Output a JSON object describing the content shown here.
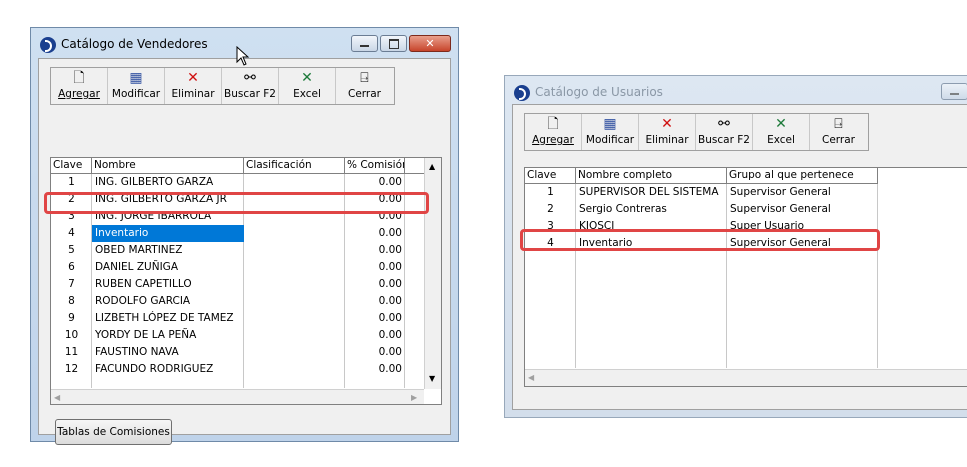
{
  "vendedores": {
    "title": "Catálogo de Vendedores",
    "toolbar": [
      {
        "label": "Agregar",
        "icon": "new-document-icon"
      },
      {
        "label": "Modificar",
        "icon": "edit-icon"
      },
      {
        "label": "Eliminar",
        "icon": "delete-x-icon"
      },
      {
        "label": "Buscar F2",
        "icon": "binoculars-icon"
      },
      {
        "label": "Excel",
        "icon": "excel-icon"
      },
      {
        "label": "Cerrar",
        "icon": "exit-door-icon"
      }
    ],
    "columns": [
      "Clave",
      "Nombre",
      "Clasificación",
      "% Comisión"
    ],
    "rows": [
      {
        "clave": "1",
        "nombre": "ING. GILBERTO GARZA",
        "clasificacion": "",
        "comision": "0.00"
      },
      {
        "clave": "2",
        "nombre": "ING. GILBERTO GARZA JR",
        "clasificacion": "",
        "comision": "0.00"
      },
      {
        "clave": "3",
        "nombre": "ING. JORGE IBARROLA",
        "clasificacion": "",
        "comision": "0.00"
      },
      {
        "clave": "4",
        "nombre": "Inventario",
        "clasificacion": "",
        "comision": "0.00"
      },
      {
        "clave": "5",
        "nombre": "OBED MARTINEZ",
        "clasificacion": "",
        "comision": "0.00"
      },
      {
        "clave": "6",
        "nombre": "DANIEL ZUÑIGA",
        "clasificacion": "",
        "comision": "0.00"
      },
      {
        "clave": "7",
        "nombre": "RUBEN CAPETILLO",
        "clasificacion": "",
        "comision": "0.00"
      },
      {
        "clave": "8",
        "nombre": "RODOLFO GARCIA",
        "clasificacion": "",
        "comision": "0.00"
      },
      {
        "clave": "9",
        "nombre": "LIZBETH LÓPEZ DE TAMEZ",
        "clasificacion": "",
        "comision": "0.00"
      },
      {
        "clave": "10",
        "nombre": "YORDY DE LA PEÑA",
        "clasificacion": "",
        "comision": "0.00"
      },
      {
        "clave": "11",
        "nombre": "FAUSTINO NAVA",
        "clasificacion": "",
        "comision": "0.00"
      },
      {
        "clave": "12",
        "nombre": "FACUNDO RODRIGUEZ",
        "clasificacion": "",
        "comision": "0.00"
      }
    ],
    "selected_row": 3,
    "tablas_button": "Tablas de Comisiones"
  },
  "usuarios": {
    "title": "Catálogo de Usuarios",
    "toolbar": [
      {
        "label": "Agregar",
        "icon": "new-document-icon"
      },
      {
        "label": "Modificar",
        "icon": "edit-icon"
      },
      {
        "label": "Eliminar",
        "icon": "delete-x-icon"
      },
      {
        "label": "Buscar F2",
        "icon": "binoculars-icon"
      },
      {
        "label": "Excel",
        "icon": "excel-icon"
      },
      {
        "label": "Cerrar",
        "icon": "exit-door-icon"
      }
    ],
    "columns": [
      "Clave",
      "Nombre completo",
      "Grupo al que pertenece"
    ],
    "rows": [
      {
        "clave": "1",
        "nombre": "SUPERVISOR DEL SISTEMA",
        "grupo": "Supervisor General"
      },
      {
        "clave": "2",
        "nombre": "Sergio Contreras",
        "grupo": "Supervisor General"
      },
      {
        "clave": "3",
        "nombre": "KIOSCI",
        "grupo": "Super Usuario"
      },
      {
        "clave": "4",
        "nombre": "Inventario",
        "grupo": "Supervisor General"
      }
    ]
  },
  "colors": {
    "selection": "#0078d7",
    "highlight": "#e04545"
  }
}
